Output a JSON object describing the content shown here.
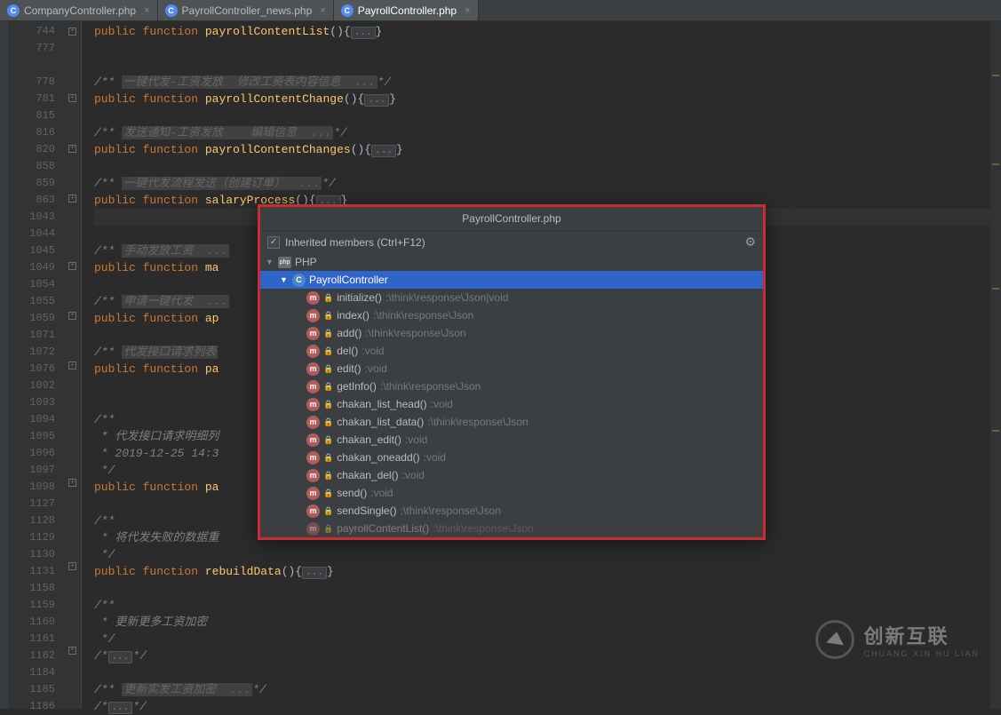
{
  "tabs": [
    {
      "icon": "C",
      "label": "CompanyController.php",
      "active": false
    },
    {
      "icon": "C",
      "label": "PayrollController_news.php",
      "active": false
    },
    {
      "icon": "C",
      "label": "PayrollController.php",
      "active": true
    }
  ],
  "gutter": [
    "744",
    "777",
    "",
    "778",
    "781",
    "815",
    "816",
    "820",
    "858",
    "859",
    "863",
    "1043",
    "1044",
    "1045",
    "1049",
    "1054",
    "1055",
    "1059",
    "1071",
    "1072",
    "1076",
    "1092",
    "1093",
    "1094",
    "1095",
    "1096",
    "1097",
    "1098",
    "1127",
    "1128",
    "1129",
    "1130",
    "1131",
    "1158",
    "1159",
    "1160",
    "1161",
    "1162",
    "1184",
    "1185",
    "1186"
  ],
  "fold": [
    "plus",
    "",
    "",
    "",
    "plus",
    "",
    "",
    "plus",
    "",
    "",
    "plus",
    "",
    "",
    "",
    "plus",
    "",
    "",
    "plus",
    "",
    "",
    "plus",
    "",
    "",
    "",
    "",
    "",
    "",
    "plus",
    "",
    "",
    "",
    "",
    "plus",
    "",
    "",
    "",
    "",
    "plus",
    "",
    "",
    ""
  ],
  "code": {
    "l0": {
      "kw1": "public",
      "kw2": "function",
      "fn": "payrollContentList",
      "suf": "(){",
      "fold": "...",
      "end": "}"
    },
    "l3": {
      "cm_open": "/** ",
      "cm": "一键代发-工资发放  修改工资表内容信息  ...",
      "cm_end": "*/"
    },
    "l4": {
      "kw1": "public",
      "kw2": "function",
      "fn": "payrollContentChange",
      "suf": "(){",
      "fold": "...",
      "end": "}"
    },
    "l6": {
      "cm_open": "/** ",
      "cm": "发送通知-工资发放    编辑信息  ...",
      "cm_end": "*/"
    },
    "l7": {
      "kw1": "public",
      "kw2": "function",
      "fn": "payrollContentChanges",
      "suf": "(){",
      "fold": "...",
      "end": "}"
    },
    "l9": {
      "cm_open": "/** ",
      "cm": "一键代发流程发送（创建订单）  ...",
      "cm_end": "*/"
    },
    "l10": {
      "kw1": "public",
      "kw2": "function",
      "fn": "salaryProcess",
      "suf": "(){",
      "fold": "...",
      "end": "}"
    },
    "l13": {
      "cm_open": "/** ",
      "cm": "手动发放工资  ...",
      "cm_end": ""
    },
    "l14": {
      "kw1": "public",
      "kw2": "function",
      "fn": "ma"
    },
    "l16": {
      "cm_open": "/** ",
      "cm": "申请一键代发  ...",
      "cm_end": ""
    },
    "l17": {
      "kw1": "public",
      "kw2": "function",
      "fn": "ap"
    },
    "l19": {
      "cm_open": "/** ",
      "cm": "代发接口请求列表",
      "cm_end": ""
    },
    "l20": {
      "kw1": "public",
      "kw2": "function",
      "fn": "pa"
    },
    "l23_a": "/**",
    "l24": " * 代发接口请求明细列",
    "l25": " * 2019-12-25 14:3",
    "l26": " */",
    "l27": {
      "kw1": "public",
      "kw2": "function",
      "fn": "pa"
    },
    "l29_a": "/**",
    "l30": " * 将代发失败的数据重",
    "l31": " */",
    "l32": {
      "kw1": "public",
      "kw2": "function",
      "fn": "rebuildData",
      "suf": "(){",
      "fold": "...",
      "end": "}"
    },
    "l34_a": "/**",
    "l35": " * 更新更多工资加密",
    "l36": " */",
    "l37": {
      "open": "/*",
      "fold": "...",
      "end": "*/"
    },
    "l39": {
      "cm_open": "/** ",
      "cm": "更新实发工资加密  ...",
      "cm_end": "*/"
    },
    "l40": {
      "open": "/*",
      "fold": "...",
      "end": "*/"
    }
  },
  "popup": {
    "title": "PayrollController.php",
    "inherited_label": "Inherited members (Ctrl+F12)",
    "php_label": "PHP",
    "class_label": "PayrollController",
    "members": [
      {
        "name": "initialize()",
        "ret": ":\\think\\response\\Json|void"
      },
      {
        "name": "index()",
        "ret": ":\\think\\response\\Json"
      },
      {
        "name": "add()",
        "ret": ":\\think\\response\\Json"
      },
      {
        "name": "del()",
        "ret": ":void"
      },
      {
        "name": "edit()",
        "ret": ":void"
      },
      {
        "name": "getInfo()",
        "ret": ":\\think\\response\\Json"
      },
      {
        "name": "chakan_list_head()",
        "ret": ":void"
      },
      {
        "name": "chakan_list_data()",
        "ret": ":\\think\\response\\Json"
      },
      {
        "name": "chakan_edit()",
        "ret": ":void"
      },
      {
        "name": "chakan_oneadd()",
        "ret": ":void"
      },
      {
        "name": "chakan_del()",
        "ret": ":void"
      },
      {
        "name": "send()",
        "ret": ":void"
      },
      {
        "name": "sendSingle()",
        "ret": ":\\think\\response\\Json"
      },
      {
        "name": "payrollContentList()",
        "ret": ":\\think\\response\\Json",
        "faded": true
      }
    ]
  },
  "watermark": {
    "cn": "创新互联",
    "en": "CHUANG XIN HU LIAN"
  }
}
